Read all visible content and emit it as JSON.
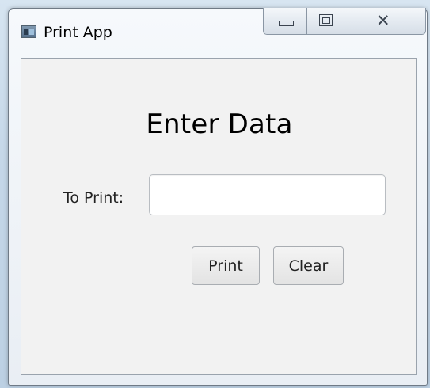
{
  "window": {
    "title": "Print App"
  },
  "caption_buttons": {
    "minimize_icon": "minimize-icon",
    "maximize_icon": "maximize-icon",
    "close_icon": "close-icon",
    "close_glyph": "✕"
  },
  "form": {
    "heading": "Enter Data",
    "field_label": "To Print:",
    "input_value": "",
    "print_label": "Print",
    "clear_label": "Clear"
  }
}
